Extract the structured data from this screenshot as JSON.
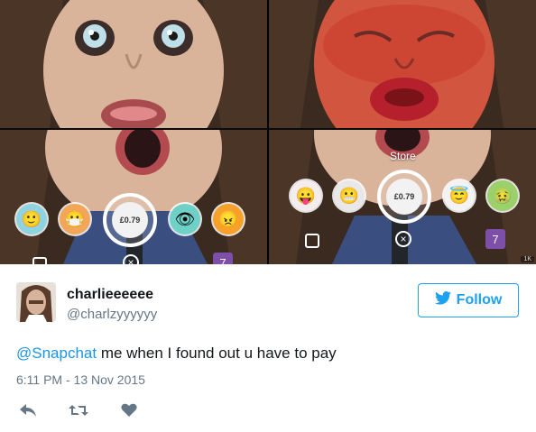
{
  "media": {
    "lens_price": "£0.79",
    "store_label": "Store",
    "lens_count": "7",
    "badge": "1K"
  },
  "tweet": {
    "display_name": "charlieeeeee",
    "handle": "@charlzyyyyyy",
    "follow_label": "Follow",
    "mention": "@Snapchat",
    "text": " me when I found out u have to pay",
    "timestamp": "6:11 PM - 13 Nov 2015"
  },
  "icons": {
    "follow": "twitter-bird-icon",
    "reply": "reply-icon",
    "retweet": "retweet-icon",
    "like": "heart-icon"
  },
  "colors": {
    "brand": "#1da1f2",
    "mention": "#1b95e0",
    "lens_badge": "#7e4fa8",
    "muted": "#657786"
  }
}
